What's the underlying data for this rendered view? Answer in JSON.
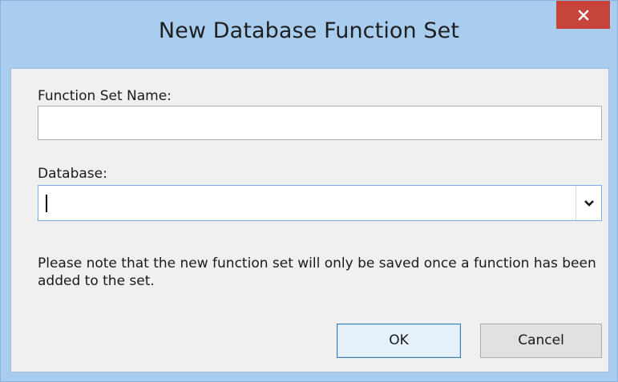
{
  "dialog": {
    "title": "New Database Function Set"
  },
  "form": {
    "function_set_name_label": "Function Set Name:",
    "function_set_name_value": "",
    "database_label": "Database:",
    "database_value": ""
  },
  "note": "Please note that the new function set will only be saved once a function has been added to the set.",
  "buttons": {
    "ok": "OK",
    "cancel": "Cancel"
  },
  "icons": {
    "close": "close-icon",
    "dropdown": "chevron-down-icon"
  },
  "colors": {
    "titlebar": "#a9cdef",
    "close_button": "#c7443a",
    "client_background": "#f0f0f0",
    "focus_border": "#7aaee4",
    "default_button_border": "#3c7fb1"
  }
}
